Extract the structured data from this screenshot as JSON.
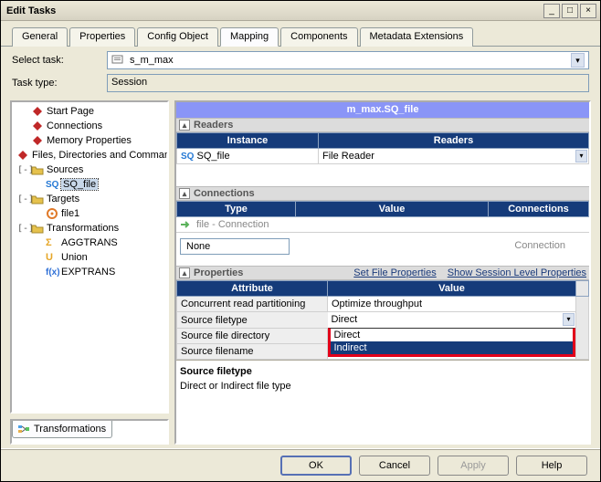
{
  "title": "Edit Tasks",
  "tabs": [
    "General",
    "Properties",
    "Config Object",
    "Mapping",
    "Components",
    "Metadata Extensions"
  ],
  "active_tab": 3,
  "form": {
    "select_label": "Select task:",
    "select_value": "s_m_max",
    "task_type_label": "Task type:",
    "task_type_value": "Session"
  },
  "tree": [
    {
      "indent": 0,
      "toggle": "",
      "icon": "diamond",
      "color": "#c02828",
      "label": "Start Page"
    },
    {
      "indent": 0,
      "toggle": "",
      "icon": "diamond",
      "color": "#c02828",
      "label": "Connections"
    },
    {
      "indent": 0,
      "toggle": "",
      "icon": "diamond",
      "color": "#c02828",
      "label": "Memory Properties"
    },
    {
      "indent": 0,
      "toggle": "",
      "icon": "diamond",
      "color": "#c02828",
      "label": "Files, Directories and Commands"
    },
    {
      "indent": 0,
      "toggle": "-",
      "icon": "folder",
      "color": "#e6c24d",
      "label": "Sources"
    },
    {
      "indent": 1,
      "toggle": "",
      "icon": "sq",
      "color": "#2478d4",
      "label": "SQ_file",
      "selected": true
    },
    {
      "indent": 0,
      "toggle": "-",
      "icon": "folder",
      "color": "#e6c24d",
      "label": "Targets"
    },
    {
      "indent": 1,
      "toggle": "",
      "icon": "target",
      "color": "#e07a2a",
      "label": "file1"
    },
    {
      "indent": 0,
      "toggle": "-",
      "icon": "folder",
      "color": "#e6c24d",
      "label": "Transformations"
    },
    {
      "indent": 1,
      "toggle": "",
      "icon": "sigma",
      "color": "#e6a628",
      "label": "AGGTRANS"
    },
    {
      "indent": 1,
      "toggle": "",
      "icon": "union",
      "color": "#e6a628",
      "label": "Union"
    },
    {
      "indent": 1,
      "toggle": "",
      "icon": "fx",
      "color": "#2e6fd6",
      "label": "EXPTRANS"
    }
  ],
  "mini_tab": "Transformations",
  "right": {
    "instance_title": "m_max.SQ_file",
    "readers": {
      "title": "Readers",
      "cols": [
        "Instance",
        "Readers"
      ],
      "rows": [
        {
          "icon": "SQ",
          "name": "SQ_file",
          "reader": "File Reader"
        }
      ]
    },
    "connections": {
      "title": "Connections",
      "cols": [
        "Type",
        "Value",
        "Connections"
      ],
      "row_label": "file - Connection",
      "none": "None",
      "placeholder": "Connection"
    },
    "properties": {
      "title": "Properties",
      "link1": "Set File Properties",
      "link2": "Show Session Level Properties",
      "cols": [
        "Attribute",
        "Value"
      ],
      "rows": [
        {
          "attr": "Concurrent read partitioning",
          "val": "Optimize throughput",
          "hl": false
        },
        {
          "attr": "Source filetype",
          "val": "Direct",
          "hl": true,
          "dd": true
        },
        {
          "attr": "Source file directory",
          "val": "",
          "hl": true
        },
        {
          "attr": "Source filename",
          "val": "",
          "hl": true
        }
      ],
      "dropdown_options": [
        "Direct",
        "Indirect"
      ],
      "dropdown_selected": 1
    },
    "desc_title": "Source filetype",
    "desc_text": "Direct or Indirect file type"
  },
  "buttons": {
    "ok": "OK",
    "cancel": "Cancel",
    "apply": "Apply",
    "help": "Help"
  }
}
